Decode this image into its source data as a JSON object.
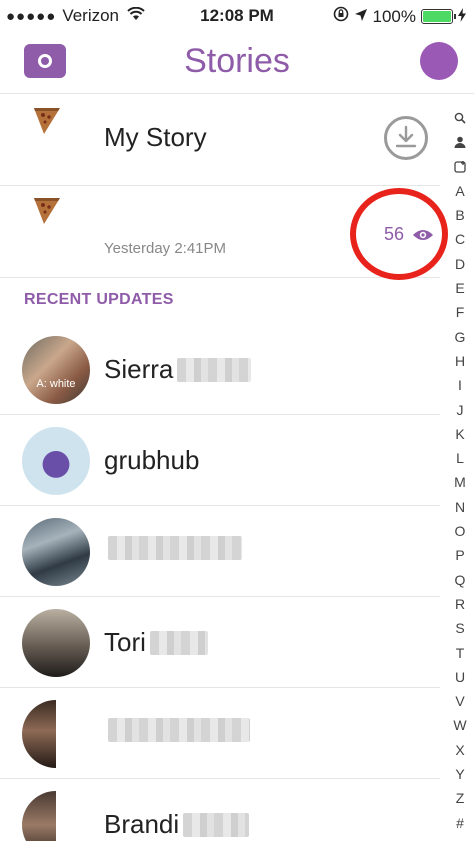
{
  "status_bar": {
    "carrier": "Verizon",
    "time": "12:08 PM",
    "battery_percent": "100%",
    "battery_level": 1.0
  },
  "nav": {
    "title": "Stories",
    "accent_color": "#8e5ca8"
  },
  "my_story": {
    "label": "My Story"
  },
  "story_snap": {
    "timestamp": "Yesterday 2:41PM",
    "view_count": "56"
  },
  "recent_updates": {
    "header": "RECENT UPDATES",
    "friends": [
      {
        "name": "Sierra",
        "avatar_caption": "A: white"
      },
      {
        "name": "grubhub"
      },
      {
        "name": ""
      },
      {
        "name": "Tori"
      },
      {
        "name": ""
      },
      {
        "name": "Brandi"
      }
    ]
  },
  "index_bar": {
    "letters": [
      "A",
      "B",
      "C",
      "D",
      "E",
      "F",
      "G",
      "H",
      "I",
      "J",
      "K",
      "L",
      "M",
      "N",
      "O",
      "P",
      "Q",
      "R",
      "S",
      "T",
      "U",
      "V",
      "W",
      "X",
      "Y",
      "Z",
      "#"
    ]
  },
  "icons": [
    "camera-icon",
    "wifi-icon",
    "location-arrow-icon",
    "rotation-lock-icon",
    "battery-icon",
    "charging-icon",
    "download-icon",
    "eye-icon",
    "pizza-thumbnail-icon",
    "search-icon",
    "person-icon",
    "add-friend-icon"
  ]
}
